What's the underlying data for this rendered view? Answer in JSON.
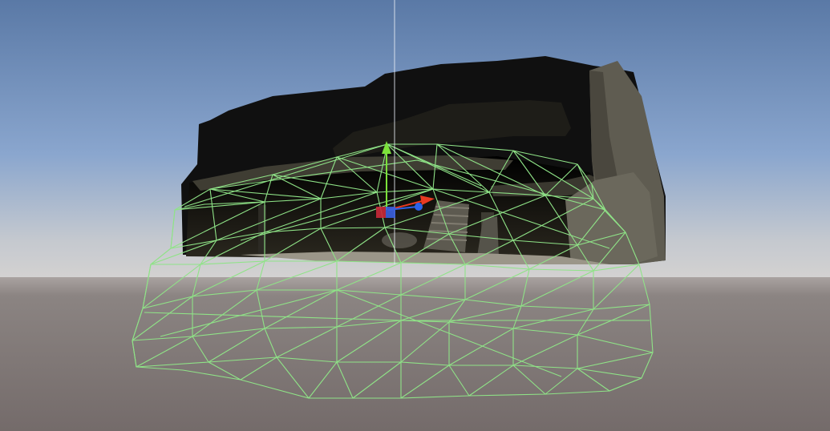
{
  "scene_view": {
    "sky_top_color": "#5a7aa8",
    "sky_mid_color": "#8ba7cf",
    "horizon_color": "#c7cbd0",
    "ground_color": "#7a7170",
    "model_dark_color": "#111111",
    "model_wall_color": "#625f55",
    "collider_wire_color": "#92e08a",
    "gizmo": {
      "x_axis_color": "#e83a22",
      "y_axis_color": "#7ce13a",
      "z_axis_color": "#2b62e8",
      "center_marker_colors": [
        "#d8283a",
        "#3a5fe0"
      ]
    },
    "icons": {
      "collider": "mesh-collider-wireframe-icon",
      "gizmo": "move-tool-gizmo-icon"
    }
  }
}
